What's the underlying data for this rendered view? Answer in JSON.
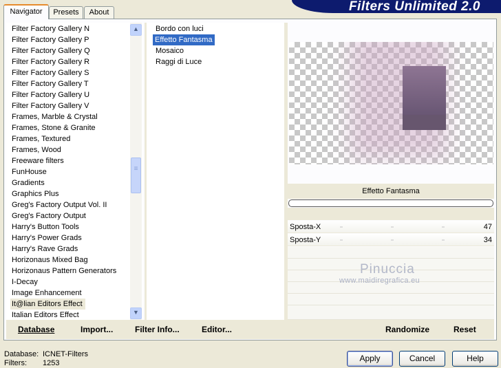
{
  "banner": {
    "title": "Filters Unlimited 2.0"
  },
  "tabs": [
    {
      "label": "Navigator"
    },
    {
      "label": "Presets"
    },
    {
      "label": "About"
    }
  ],
  "categories": [
    "Filter Factory Gallery N",
    "Filter Factory Gallery P",
    "Filter Factory Gallery Q",
    "Filter Factory Gallery R",
    "Filter Factory Gallery S",
    "Filter Factory Gallery T",
    "Filter Factory Gallery U",
    "Filter Factory Gallery V",
    "Frames, Marble & Crystal",
    "Frames, Stone & Granite",
    "Frames, Textured",
    "Frames, Wood",
    "Freeware filters",
    "FunHouse",
    "Gradients",
    "Graphics Plus",
    "Greg's Factory Output Vol. II",
    "Greg's Factory Output",
    "Harry's Button Tools",
    "Harry's Power Grads",
    "Harry's Rave Grads",
    "Horizonaus Mixed Bag",
    "Horizonaus Pattern Generators",
    "I-Decay",
    "Image Enhancement",
    "It@lian Editors Effect",
    "Italian Editors Effect"
  ],
  "selected_category": "It@lian Editors Effect",
  "filters": [
    "Bordo con luci",
    "Effetto Fantasma",
    "Mosaico",
    "Raggi di Luce"
  ],
  "selected_filter": "Effetto Fantasma",
  "preview": {
    "filter_name": "Effetto Fantasma",
    "watermark_line1": "Pinuccia",
    "watermark_line2": "www.maidiregrafica.eu",
    "glow_color": "#c8a0be",
    "tile_color": "#7a6680"
  },
  "sliders": [
    {
      "label": "Sposta-X",
      "value": "47",
      "fraction": 0.18
    },
    {
      "label": "Sposta-Y",
      "value": "34",
      "fraction": 0.13
    }
  ],
  "bottom_links": {
    "database": "Database",
    "import": "Import...",
    "filter_info": "Filter Info...",
    "editor": "Editor...",
    "randomize": "Randomize",
    "reset": "Reset"
  },
  "status": {
    "database_label": "Database:",
    "database_value": "ICNET-Filters",
    "filters_label": "Filters:",
    "filters_value": "1253"
  },
  "buttons": {
    "apply": "Apply",
    "cancel": "Cancel",
    "help": "Help"
  }
}
